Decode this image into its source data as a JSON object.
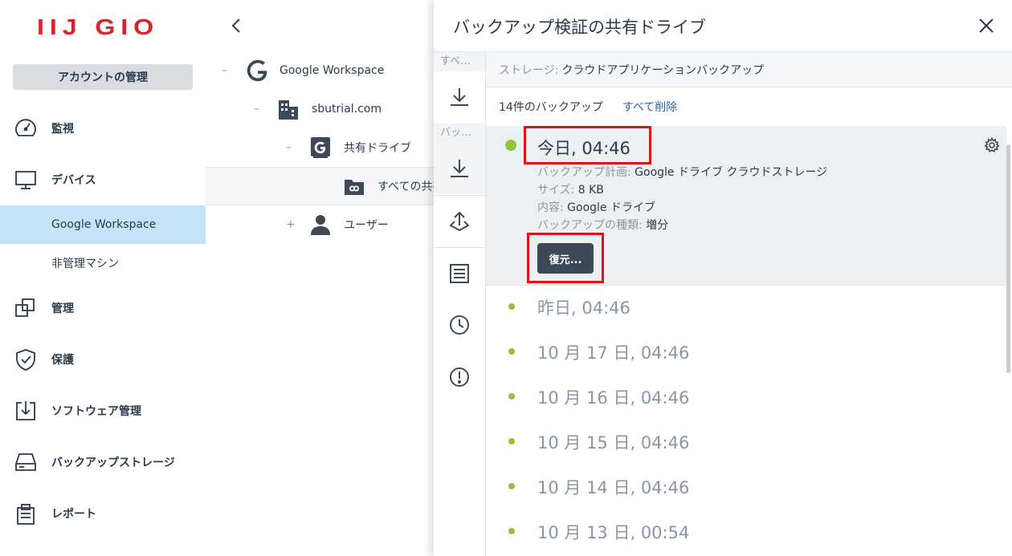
{
  "sidebar": {
    "logo": "IIJ GIO",
    "account_button": "アカウントの管理",
    "items": [
      {
        "label": "監視",
        "icon": "gauge-icon"
      },
      {
        "label": "デバイス",
        "icon": "monitor-icon"
      },
      {
        "label": "管理",
        "icon": "copy-icon"
      },
      {
        "label": "保護",
        "icon": "shield-check-icon"
      },
      {
        "label": "ソフトウェア管理",
        "icon": "software-download-icon"
      },
      {
        "label": "バックアップストレージ",
        "icon": "storage-drive-icon"
      },
      {
        "label": "レポート",
        "icon": "report-icon"
      }
    ],
    "sub_items": [
      {
        "label": "Google Workspace",
        "active": true
      },
      {
        "label": "非管理マシン",
        "active": false
      }
    ]
  },
  "tree": {
    "rows": [
      {
        "toggle": "–",
        "label": "Google Workspace",
        "icon": "google-icon"
      },
      {
        "toggle": "–",
        "label": "sbutrial.com",
        "icon": "building-icon"
      },
      {
        "toggle": "–",
        "label": "共有ドライブ",
        "icon": "google-drive-box-icon"
      },
      {
        "toggle": "",
        "label": "すべての共有",
        "icon": "shared-folder-icon"
      },
      {
        "toggle": "+",
        "label": "ユーザー",
        "icon": "user-icon"
      }
    ]
  },
  "panel": {
    "title": "バックアップ検証の共有ドライブ",
    "rail_captions": [
      "すべ…",
      "バッ…"
    ],
    "storage_label": "ストレージ:",
    "storage_value": "クラウドアプリケーションバックアップ",
    "backup_count": "14件のバックアップ",
    "delete_all": "すべて削除",
    "selected": {
      "date": "今日, 04:46",
      "plan_label": "バックアップ計画:",
      "plan_value": "Google ドライブ クラウドストレージ",
      "size_label": "サイズ:",
      "size_value": "8 KB",
      "content_label": "内容:",
      "content_value": "Google ドライブ",
      "type_label": "バックアップの種類:",
      "type_value": "増分",
      "restore_button": "復元..."
    },
    "entries": [
      "昨日, 04:46",
      "10 月 17 日, 04:46",
      "10 月 16 日, 04:46",
      "10 月 15 日, 04:46",
      "10 月 14 日, 04:46",
      "10 月 13 日, 00:54"
    ]
  },
  "colors": {
    "accent_green": "#8cc43a",
    "highlight_red": "#e0121b",
    "active_blue": "#c5e2f6",
    "logo_red": "#d5242b"
  }
}
